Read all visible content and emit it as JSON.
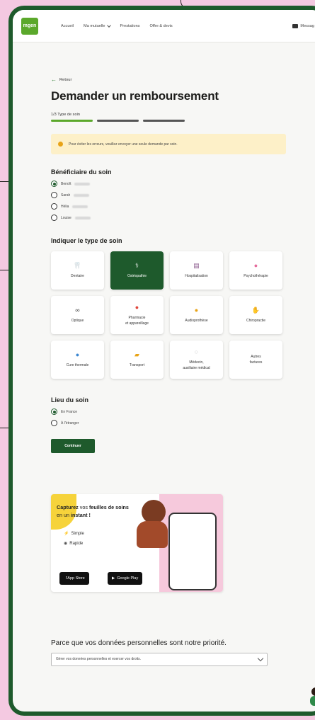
{
  "header": {
    "logo_text": "mgen",
    "nav": [
      {
        "label": "Accueil"
      },
      {
        "label": "Ma mutuelle",
        "has_dropdown": true
      },
      {
        "label": "Prestations"
      },
      {
        "label": "Offre & devis"
      }
    ],
    "messages_label": "Messag"
  },
  "back": {
    "label": "Retour"
  },
  "page_title": "Demander un remboursement",
  "steps": {
    "label": "1/3  Type de soin",
    "count": 3,
    "current": 1
  },
  "alert": {
    "text": "Pour éviter les erreurs, veuillez envoyer une seule demande par soin."
  },
  "beneficiary": {
    "title": "Bénéficiaire du soin",
    "options": [
      {
        "label": "Benoît",
        "checked": true
      },
      {
        "label": "Sarah",
        "checked": false
      },
      {
        "label": "Hélia",
        "checked": false
      },
      {
        "label": "Louise",
        "checked": false
      }
    ]
  },
  "care_type": {
    "title": "Indiquer le type de soin",
    "tiles": [
      {
        "label": "Dentaire",
        "icon": "tooth-icon",
        "selected": false
      },
      {
        "label": "Ostéopathie",
        "icon": "osteopathy-icon",
        "selected": true
      },
      {
        "label": "Hospitalisation",
        "icon": "hospital-icon",
        "selected": false
      },
      {
        "label": "Psychothérapie",
        "icon": "brain-icon",
        "selected": false
      },
      {
        "label": "Optique",
        "icon": "glasses-icon",
        "selected": false
      },
      {
        "label": "Pharmacie\net appareillage",
        "icon": "pill-icon",
        "selected": false
      },
      {
        "label": "Audioprothèse",
        "icon": "ear-icon",
        "selected": false
      },
      {
        "label": "Chiropractie",
        "icon": "hand-icon",
        "selected": false
      },
      {
        "label": "Cure thermale",
        "icon": "water-drop-icon",
        "selected": false
      },
      {
        "label": "Transport",
        "icon": "car-icon",
        "selected": false
      },
      {
        "label": "Médecin,\nauxiliaire médical",
        "icon": "doctor-icon",
        "selected": false
      },
      {
        "label": "Autres\nfactures",
        "icon": "",
        "selected": false
      }
    ]
  },
  "location": {
    "title": "Lieu du soin",
    "options": [
      {
        "label": "En France",
        "checked": true
      },
      {
        "label": "À l'étranger",
        "checked": false
      }
    ]
  },
  "submit_label": "Continuer",
  "promo": {
    "title_part1": "Capturez",
    "title_part2": " vos ",
    "title_part3": "feuilles de soins",
    "title_part4": "en un ",
    "title_part5": "instant !",
    "feature1": "Simple",
    "feature2": "Rapide",
    "app_store": "l'App Store",
    "google_play": "Google Play"
  },
  "privacy": {
    "heading": "Parce que vos données personnelles sont notre priorité.",
    "select_label": "Gérer vos données personnelles et exercer vos droits."
  },
  "colors": {
    "brand_green": "#1e5a2c",
    "accent_green": "#5ba82b",
    "background_pink": "#f4c9e1",
    "alert_yellow": "#fdf0c8"
  }
}
